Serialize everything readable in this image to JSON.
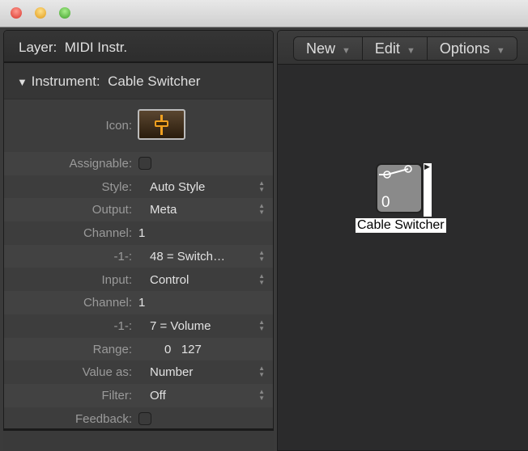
{
  "window": {
    "traffic_lights": {
      "close": "#ee5a52",
      "minimize": "#f5b840",
      "zoom": "#5fc04a"
    }
  },
  "inspector": {
    "layer_label": "Layer:",
    "layer_value": "MIDI Instr.",
    "instrument_label": "Instrument:",
    "instrument_value": "Cable Switcher",
    "icon_label": "Icon:",
    "rows": [
      {
        "label": "Assignable:",
        "type": "checkbox",
        "checked": false
      },
      {
        "label": "Style:",
        "value": "Auto Style",
        "type": "popup"
      },
      {
        "label": "Output:",
        "value": "Meta",
        "type": "popup"
      },
      {
        "label": "Channel:",
        "value": "1",
        "type": "number"
      },
      {
        "label": "-1-:",
        "value": "48 = Switch…",
        "type": "popup"
      },
      {
        "label": "Input:",
        "value": "Control",
        "type": "popup"
      },
      {
        "label": "Channel:",
        "value": "1",
        "type": "number"
      },
      {
        "label": "-1-:",
        "value": "7 = Volume",
        "type": "popup"
      },
      {
        "label": "Range:",
        "value": "0   127",
        "type": "range"
      },
      {
        "label": "Value as:",
        "value": "Number",
        "type": "popup"
      },
      {
        "label": "Filter:",
        "value": "Off",
        "type": "popup"
      },
      {
        "label": "Feedback:",
        "type": "checkbox",
        "checked": false
      }
    ]
  },
  "toolbar": {
    "new": "New",
    "edit": "Edit",
    "options": "Options"
  },
  "canvas": {
    "object": {
      "name": "Cable Switcher",
      "value": "0"
    }
  }
}
